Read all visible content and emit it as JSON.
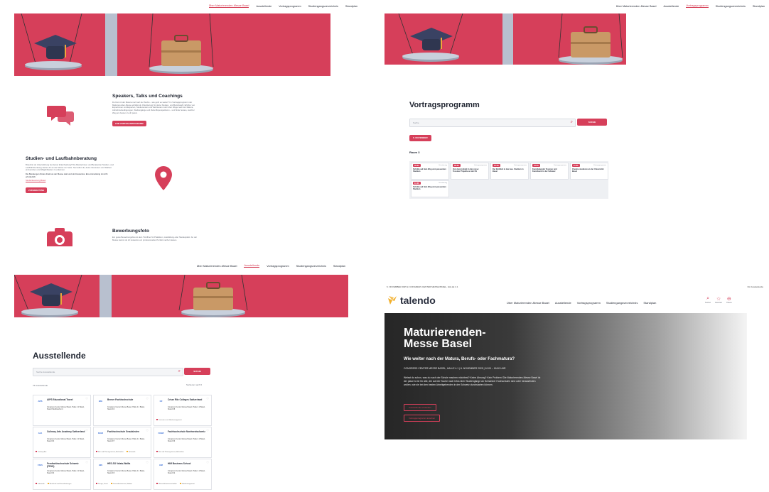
{
  "nav": {
    "items": [
      "Über Maturierenden-Messe Basel",
      "Ausstellende",
      "Vortragsprogramm",
      "Studiengangsverzeichnis",
      "Standplan"
    ]
  },
  "colors": {
    "brand": "#d63f5a",
    "hero_bg": "#d63f5a",
    "pillar": "#b8c0cf",
    "scale_pan": "#9aa4b4"
  },
  "panel1": {
    "speakers": {
      "title": "Speakers, Talks und Coachings",
      "text": "Du bist mit der Matura noch auf der Suche – wie geht es weiter? Im Vortragsprogramm der Maturierenden-Messe erhältst du Orientierung für deine Studien- und Berufswahl. Erfahre von Expertinnen und Experten, Studierenden und Fachleuten mehr über Wege nach der Matura, Aufnahmebedingungen, Studiengänge und Zukunftsperspektiven – und finde heraus, welcher Weg am besten zu dir passt.",
      "button": "ZUM VORTRAGSPROGRAMM"
    },
    "beratung": {
      "title": "Studien- und Laufbahnberatung",
      "text": "Brauchst du Unterstützung bei deiner Entscheidung? Die Beraterinnen und Beratender Studien- und Laufbahnberatung stehen dir an der Messe zur Seite. Sie helfen dir, deine Interessen und Stärken einzuordnen und Möglichkeiten zu erkennen.",
      "note": "Die Beratungen finden direkt an der Messe statt und sind kostenlos. Eine Anmeldung ist nicht erforderlich.",
      "link": "Studienberatung Basel",
      "button": "ZUR BERATUNG"
    },
    "foto": {
      "title": "Bewerbungsfoto",
      "text": "Ein gutes Bewerbungsfoto ist dein Türöffner für Praktikum, Ausbildung oder Studienplatz. An der Messe kannst du dir kostenlos ein professionelles Porträt machen lassen."
    }
  },
  "panel2": {
    "title": "Vortragsprogramm",
    "search_placeholder": "Suche",
    "search_button": "SUCHE",
    "date_button": "6. NOVEMBER",
    "room": "Raum 3",
    "talks": [
      {
        "tag": "09:00",
        "cat": "Orientierung",
        "title": "Schritte auf dem Weg zum passenden Studium"
      },
      {
        "tag": "09:30",
        "cat": "Vortragsprogramm",
        "title": "Vom Geist direkt in die Lösse: Tessiner Projekte an der FH"
      },
      {
        "tag": "10:00",
        "cat": "Vortragsprogramm",
        "title": "Der Einblick in das bau- Studium in Basel"
      },
      {
        "tag": "10:30",
        "cat": "Vortragsprogramm",
        "title": "Kunstkalender Tessiner und Kunstberuf in der Schweiz"
      },
      {
        "tag": "11:00",
        "cat": "Vortragsprogramm",
        "title": "Chemie studieren an der Universität Basel"
      },
      {
        "tag": "11:30",
        "cat": "Orientierung",
        "title": "Schritte auf dem Weg zum passenden Studium"
      }
    ]
  },
  "panel3": {
    "title": "Ausstellende",
    "search_placeholder": "Suche Ausstellende",
    "search_button": "SUCHE",
    "count": "76 Ausstellende",
    "sort": "Sortieren nach",
    "exhibitors": [
      {
        "logo": "AIPS",
        "name": "AIPS Educational Travel",
        "addr": "Congress Center Messe Basel, Halle 4.1 Basel, Stand Stubbleshot 4",
        "tags": []
      },
      {
        "logo": "BFH",
        "name": "Berner Fachhochschule",
        "addr": "Congress Center Messe Basel, Halle 4.1 Basel, Stand F4",
        "tags": []
      },
      {
        "logo": "CR",
        "name": "César Ritz Colleges Switzerland",
        "addr": "Congress Center Messe Basel, Halle 4.1 Basel, Stand F8",
        "tags": [
          "Tourismus und Hotelmanagement"
        ]
      },
      {
        "logo": "CAA",
        "name": "Culinary Arts Academy Switzerland",
        "addr": "Congress Center Messe Basel, Halle 4.1 Basel, Stand F4",
        "tags": [
          "Culinary Arts"
        ]
      },
      {
        "logo": "FHGR",
        "name": "Fachhochschule Graubünden",
        "addr": "Congress Center Messe Basel, Halle 4.1 Basel, Stand F7",
        "tags": [
          "Bau und Planungswesen, Architektur",
          "Informatik"
        ]
      },
      {
        "logo": "FHNW",
        "name": "Fachhochschule Nordwestschweiz",
        "addr": "Congress Center Messe Basel, Halle 4.1 Basel, Stand F6",
        "tags": [
          "Bau und Planungswesen, Architektur"
        ]
      },
      {
        "logo": "FFHS",
        "name": "Fernfachhochschule Schweiz (FFHS)",
        "addr": "Congress Center Messe Basel, Halle 4.1 Basel, Stand F4",
        "tags": [
          "Informatik",
          "Wirtschaft und Dienstleistungen"
        ]
      },
      {
        "logo": "HES",
        "name": "HES-SO Valais-Wallis",
        "addr": "Congress Center Messe Basel, Halle 4.1 Basel, Stand F3",
        "tags": [
          "Design, Kunst",
          "Gesundheitswesen, Medizin"
        ]
      },
      {
        "logo": "HIM",
        "name": "HIM Business School",
        "addr": "Congress Center Messe Basel, Halle 4.1 Basel, Stand F2",
        "tags": [
          "Wirtschaftswissenschaften",
          "Hotelmanagement"
        ]
      }
    ]
  },
  "panel4": {
    "topbar": "6. NOVEMBER 2025 in CONGRESS CENTER MESSE BASEL, HALLE 4.1",
    "topbar_right": "Für Ausstellende",
    "logo": "talendo",
    "nav_icons": [
      {
        "name": "search-icon",
        "label": "Suchen"
      },
      {
        "name": "star-icon",
        "label": "Favoriten"
      },
      {
        "name": "ticket-icon",
        "label": "Tickets"
      }
    ],
    "hero_title": "Maturierenden-Messe Basel",
    "hero_sub": "Wie weiter nach der Matura, Berufs- oder Fachmatura?",
    "hero_info": "CONGRESS CENTER MESSE BASEL, HALLE 4.1 | 6. NOVEMBER 2025 | 10:00 – 16:00 UHR",
    "hero_text": "Weisst du schon, was du nach der Schule machen möchtest? Keine Ahnung? Kein Problem! Die Maturierenden-Messe Basel ist der place to be für alle, die auf der Suche nach Infos über Studiengänge an Schweizer Hochschulen sind oder herausfinden wollen, wie sie bei den besten Arbeitgebenden in der Schweiz durchstarten können.",
    "btn1": "Ausstellende entdecken",
    "btn2": "Vortragsprogramm ansehen"
  }
}
